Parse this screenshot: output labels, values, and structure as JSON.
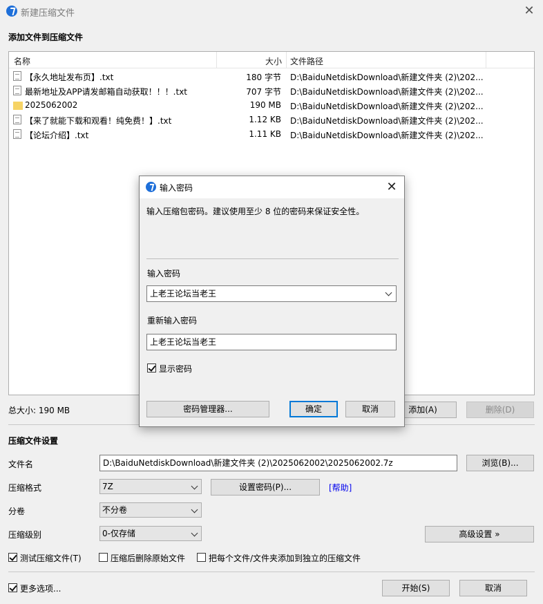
{
  "window": {
    "title": "新建压缩文件",
    "close_glyph": "✕"
  },
  "add_section": {
    "heading": "添加文件到压缩文件",
    "columns": {
      "name": "名称",
      "size": "大小",
      "path": "文件路径"
    },
    "files": [
      {
        "icon": "text-file-icon",
        "name": "【永久地址发布页】.txt",
        "size": "180 字节",
        "path": "D:\\BaiduNetdiskDownload\\新建文件夹 (2)\\202..."
      },
      {
        "icon": "text-file-icon",
        "name": "最新地址及APP请发邮箱自动获取！！！.txt",
        "size": "707 字节",
        "path": "D:\\BaiduNetdiskDownload\\新建文件夹 (2)\\202..."
      },
      {
        "icon": "folder-icon",
        "name": "2025062002",
        "size": "190 MB",
        "path": "D:\\BaiduNetdiskDownload\\新建文件夹 (2)\\202..."
      },
      {
        "icon": "text-file-icon",
        "name": "【来了就能下载和观看！纯免费！】.txt",
        "size": "1.12 KB",
        "path": "D:\\BaiduNetdiskDownload\\新建文件夹 (2)\\202..."
      },
      {
        "icon": "text-file-icon",
        "name": "【论坛介绍】.txt",
        "size": "1.11 KB",
        "path": "D:\\BaiduNetdiskDownload\\新建文件夹 (2)\\202..."
      }
    ],
    "total_size": "总大小: 190 MB",
    "add_button": "添加(A)",
    "delete_button": "删除(D)"
  },
  "settings": {
    "heading": "压缩文件设置",
    "filename_label": "文件名",
    "filename_value": "D:\\BaiduNetdiskDownload\\新建文件夹 (2)\\2025062002\\2025062002.7z",
    "browse_button": "浏览(B)...",
    "format_label": "压缩格式",
    "format_value": "7Z",
    "set_password_button": "设置密码(P)...",
    "help_link": "[帮助]",
    "volume_label": "分卷",
    "volume_value": "不分卷",
    "level_label": "压缩级别",
    "level_value": "0-仅存储",
    "advanced_button": "高级设置 »",
    "test_archive": {
      "label": "测试压缩文件(T)",
      "checked": true
    },
    "delete_after": {
      "label": "压缩后删除原始文件",
      "checked": false
    },
    "separate_archives": {
      "label": "把每个文件/文件夹添加到独立的压缩文件",
      "checked": false
    },
    "more_options": {
      "label": "更多选项...",
      "checked": true
    },
    "start_button": "开始(S)",
    "cancel_button": "取消"
  },
  "password_dialog": {
    "title": "输入密码",
    "close_glyph": "✕",
    "info": "输入压缩包密码。建议使用至少 8 位的密码来保证安全性。",
    "password_label": "输入密码",
    "password_value": "上老王论坛当老王",
    "confirm_label": "重新输入密码",
    "confirm_value": "上老王论坛当老王",
    "show_password": {
      "label": "显示密码",
      "checked": true
    },
    "manager_button": "密码管理器...",
    "ok_button": "确定",
    "cancel_button": "取消"
  }
}
